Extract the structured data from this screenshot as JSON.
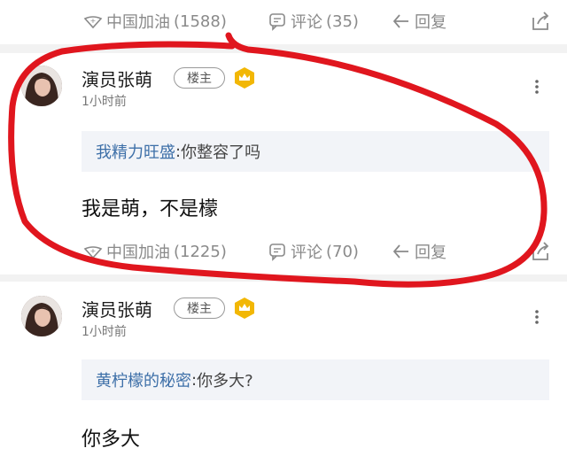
{
  "actions_top": {
    "like_label": "中国加油",
    "like_count": "(1588)",
    "comment_label": "评论",
    "comment_count": "(35)",
    "reply_label": "回复"
  },
  "comments": [
    {
      "author": "演员张萌",
      "badge": "楼主",
      "time": "1小时前",
      "quote_user": "我精力旺盛",
      "quote_sep": ":",
      "quote_text": " 你整容了吗",
      "content": "我是萌，不是檬",
      "like_label": "中国加油",
      "like_count": "(1225)",
      "comment_label": "评论",
      "comment_count": "(70)",
      "reply_label": "回复"
    },
    {
      "author": "演员张萌",
      "badge": "楼主",
      "time": "1小时前",
      "quote_user": "黄柠檬的秘密",
      "quote_sep": ":",
      "quote_text": " 你多大?",
      "content": "你多大"
    }
  ],
  "colors": {
    "annotation_red": "#e0161e",
    "link_blue": "#3d6fa8",
    "crown_gold": "#f2b705",
    "icon_gray": "#8a8a8a"
  },
  "icons": [
    "like-icon",
    "comment-icon",
    "reply-icon",
    "share-icon",
    "more-icon",
    "crown-icon"
  ]
}
